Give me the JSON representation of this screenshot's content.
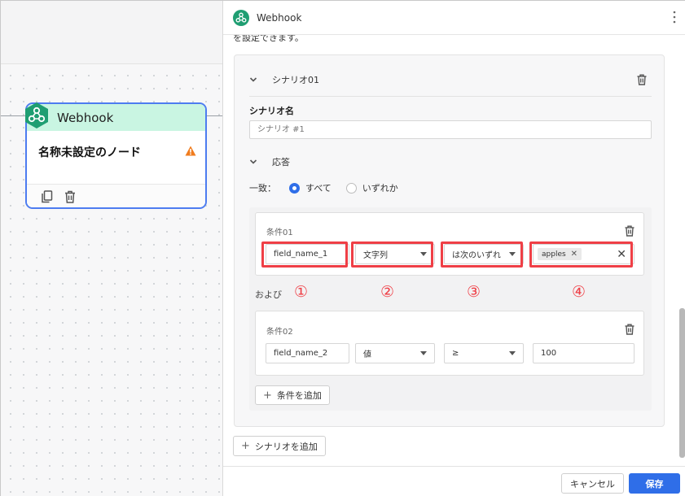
{
  "node": {
    "type_label": "Webhook",
    "name": "名称未設定のノード"
  },
  "panel": {
    "title": "Webhook",
    "cut_description": "を設定できます。"
  },
  "scenario": {
    "header": "シナリオ01",
    "name_label": "シナリオ名",
    "name_placeholder": "シナリオ #1",
    "response_label": "応答",
    "match_label": "一致：",
    "match_options": [
      "すべて",
      "いずれか"
    ],
    "match_selected": "すべて"
  },
  "conditions": [
    {
      "title": "条件01",
      "field": "field_name_1",
      "type": "文字列",
      "operator": "は次のいずれ",
      "chips": [
        "apples"
      ]
    },
    {
      "title": "条件02",
      "field": "field_name_2",
      "type": "値",
      "operator": "≥",
      "value": "100"
    }
  ],
  "and_label": "および",
  "markers": [
    "①",
    "②",
    "③",
    "④"
  ],
  "buttons": {
    "add_condition": "条件を追加",
    "add_scenario": "シナリオを追加",
    "cancel": "キャンセル",
    "save": "保存"
  },
  "colors": {
    "accent": "#2f6ee8",
    "highlight": "#ef3f46",
    "node_header": "#c9f5e2",
    "node_border": "#4d7cf0",
    "webhook_green": "#1f9e72",
    "warning": "#f07c1e"
  }
}
